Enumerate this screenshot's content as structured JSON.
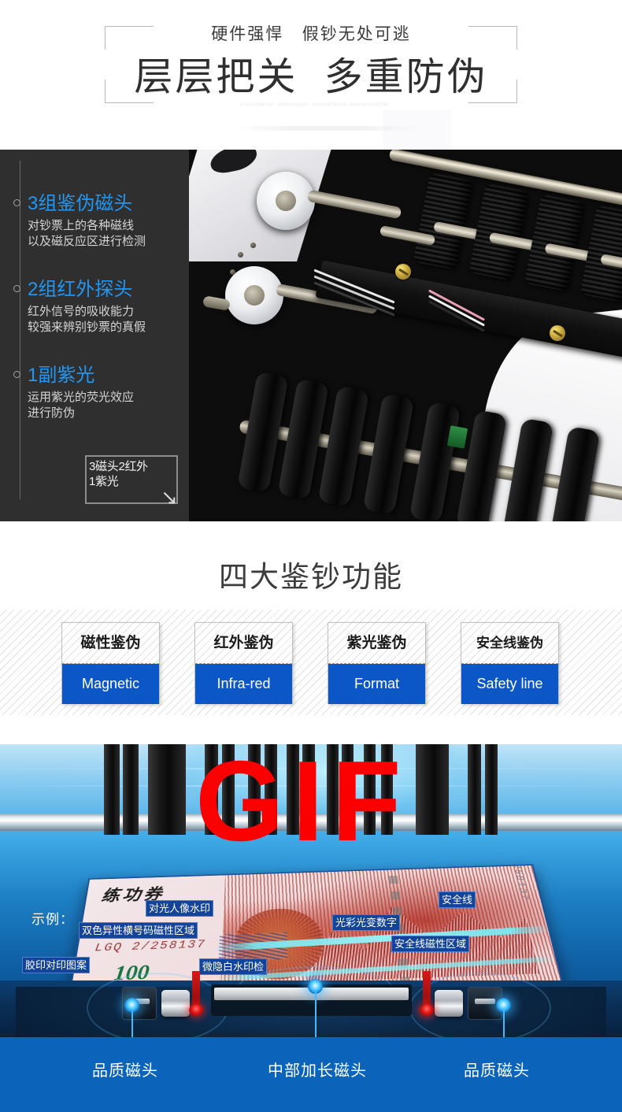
{
  "hero": {
    "subtitle": "硬件强悍   假钞无处可逃",
    "title": "层层把关  多重防伪",
    "ghost": "本产品采用全新硬件架构，多重鉴伪技术层层把关，对各种伪钞进行精准识别，确保每一张钞票的真实可靠。"
  },
  "panel": {
    "features": [
      {
        "title": "3组鉴伪磁头",
        "desc": "对钞票上的各种磁线\n以及磁反应区进行检测"
      },
      {
        "title": "2组红外探头",
        "desc": "红外信号的吸收能力\n较强来辨别钞票的真假"
      },
      {
        "title": "1副紫光",
        "desc": "运用紫光的荧光效应\n进行防伪"
      }
    ],
    "badge": {
      "text": "3磁头2红外\n1紫光",
      "arrow": "↘"
    }
  },
  "functions": {
    "title": "四大鉴钞功能",
    "accent_color": "#0b57c8",
    "cards": [
      {
        "cn": "磁性鉴伪",
        "en": "Magnetic"
      },
      {
        "cn": "红外鉴伪",
        "en": "Infra-red"
      },
      {
        "cn": "紫光鉴伪",
        "en": "Format"
      },
      {
        "cn": "安全线鉴伪",
        "en": "Safety line"
      }
    ]
  },
  "gif": {
    "watermark": "GIF",
    "sample_label": "示例：",
    "bill": {
      "title": "练功券",
      "serial": "LGQ  2/258137",
      "serial_vertical": "LGQ 27258137",
      "denomination": "100"
    },
    "bill_tags": [
      "对光人像水印",
      "光彩光变数字",
      "双色异性横号码磁性区域",
      "胶印对印图案",
      "微隐白水印检",
      "安全线",
      "安全线磁性区域"
    ],
    "bottom_labels": [
      "品质磁头",
      "中部加长磁头",
      "品质磁头"
    ]
  }
}
